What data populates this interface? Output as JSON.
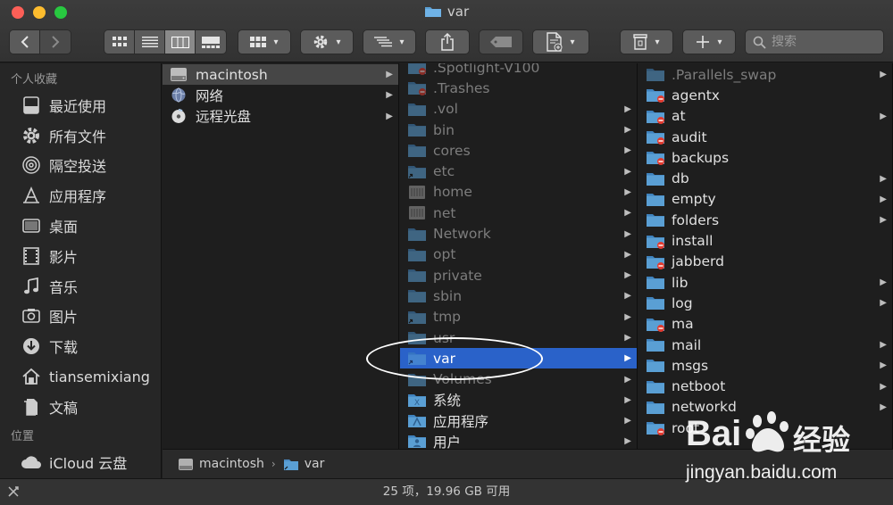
{
  "window": {
    "title": "var"
  },
  "toolbar": {
    "search_placeholder": "搜索",
    "caret": "▾"
  },
  "sidebar": {
    "favorites_header": "个人收藏",
    "favorites": [
      {
        "label": "最近使用",
        "icon": "recents-icon"
      },
      {
        "label": "所有文件",
        "icon": "gear-icon"
      },
      {
        "label": "隔空投送",
        "icon": "airdrop-icon"
      },
      {
        "label": "应用程序",
        "icon": "applications-icon"
      },
      {
        "label": "桌面",
        "icon": "desktop-icon"
      },
      {
        "label": "影片",
        "icon": "movies-icon"
      },
      {
        "label": "音乐",
        "icon": "music-icon"
      },
      {
        "label": "图片",
        "icon": "pictures-icon"
      },
      {
        "label": "下载",
        "icon": "downloads-icon"
      },
      {
        "label": "tiansemixiang",
        "icon": "home-icon"
      },
      {
        "label": "文稿",
        "icon": "documents-icon"
      }
    ],
    "locations_header": "位置",
    "locations": [
      {
        "label": "iCloud 云盘",
        "icon": "icloud-icon"
      }
    ]
  },
  "column1": [
    {
      "label": "macintosh",
      "icon": "hard-drive-icon",
      "arrow": true,
      "active": true
    },
    {
      "label": "网络",
      "icon": "network-globe-icon",
      "arrow": true
    },
    {
      "label": "远程光盘",
      "icon": "remote-disc-icon",
      "arrow": true
    }
  ],
  "column2": [
    {
      "label": ".Spotlight-V100",
      "hidden": true,
      "badge": "restricted",
      "arrow": false
    },
    {
      "label": ".Trashes",
      "hidden": true,
      "badge": "restricted",
      "arrow": false
    },
    {
      "label": ".vol",
      "hidden": true,
      "arrow": true
    },
    {
      "label": "bin",
      "hidden": true,
      "arrow": true
    },
    {
      "label": "cores",
      "hidden": true,
      "arrow": true
    },
    {
      "label": "etc",
      "hidden": true,
      "badge": "alias",
      "arrow": true
    },
    {
      "label": "home",
      "hidden": true,
      "kind": "server",
      "arrow": true
    },
    {
      "label": "net",
      "hidden": true,
      "kind": "server",
      "arrow": true
    },
    {
      "label": "Network",
      "hidden": true,
      "arrow": true
    },
    {
      "label": "opt",
      "hidden": true,
      "arrow": true
    },
    {
      "label": "private",
      "hidden": true,
      "arrow": true
    },
    {
      "label": "sbin",
      "hidden": true,
      "arrow": true
    },
    {
      "label": "tmp",
      "hidden": true,
      "badge": "alias",
      "arrow": true
    },
    {
      "label": "usr",
      "hidden": true,
      "arrow": true
    },
    {
      "label": "var",
      "hidden": true,
      "badge": "alias",
      "arrow": true,
      "selected": true
    },
    {
      "label": "Volumes",
      "hidden": true,
      "arrow": true
    },
    {
      "label": "系统",
      "kind": "system",
      "arrow": true
    },
    {
      "label": "应用程序",
      "kind": "apps",
      "arrow": true
    },
    {
      "label": "用户",
      "kind": "users",
      "arrow": true
    }
  ],
  "column3": [
    {
      "label": ".Parallels_swap",
      "hidden": true,
      "arrow": true
    },
    {
      "label": "agentx",
      "badge": "restricted",
      "arrow": false
    },
    {
      "label": "at",
      "badge": "restricted",
      "arrow": true
    },
    {
      "label": "audit",
      "badge": "restricted",
      "arrow": false
    },
    {
      "label": "backups",
      "badge": "restricted",
      "arrow": false
    },
    {
      "label": "db",
      "arrow": true
    },
    {
      "label": "empty",
      "arrow": true
    },
    {
      "label": "folders",
      "arrow": true
    },
    {
      "label": "install",
      "badge": "restricted",
      "arrow": false
    },
    {
      "label": "jabberd",
      "badge": "restricted",
      "arrow": false
    },
    {
      "label": "lib",
      "arrow": true
    },
    {
      "label": "log",
      "arrow": true
    },
    {
      "label": "ma",
      "badge": "restricted",
      "arrow": false
    },
    {
      "label": "mail",
      "arrow": true
    },
    {
      "label": "msgs",
      "arrow": true
    },
    {
      "label": "netboot",
      "arrow": true
    },
    {
      "label": "networkd",
      "arrow": true
    },
    {
      "label": "root",
      "badge": "restricted",
      "arrow": false
    }
  ],
  "pathbar": {
    "segments": [
      "macintosh",
      "var"
    ],
    "separator": "›"
  },
  "statusbar": {
    "text": "25 项，19.96 GB 可用"
  },
  "watermark": {
    "brand_latin": "Bai",
    "brand_cn": "经验",
    "url": "jingyan.baidu.com"
  },
  "colors": {
    "selection": "#2a62c9",
    "folder": "#5a9fd4",
    "restricted_badge": "#e23b30"
  }
}
